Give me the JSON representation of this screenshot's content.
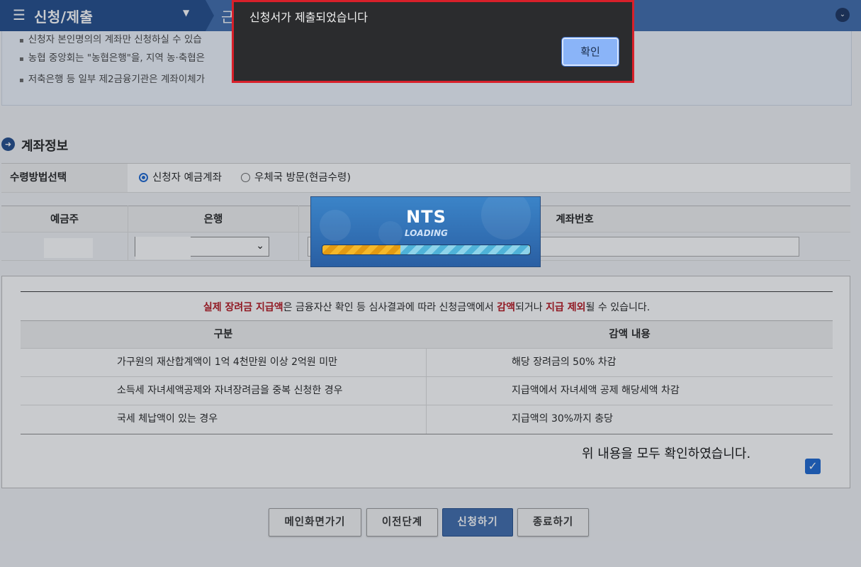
{
  "topbar": {
    "menu_icon": "☰",
    "menu_title": "신청/제출",
    "menu_caret": "▼",
    "next_crumb": "근",
    "collapse_icon": "⌄"
  },
  "notice": {
    "items": [
      "신청자 본인명의의 계좌만 신청하실 수 있습",
      "농협 중앙회는 \"농협은행\"을, 지역 농·축협은",
      "저축은행 등 일부 제2금융기관은 계좌이체가"
    ]
  },
  "account_section": {
    "title": "계좌정보",
    "method_label": "수령방법선택",
    "options": [
      {
        "label": "신청자 예금계좌",
        "selected": true
      },
      {
        "label": "우체국 방문(현금수령)",
        "selected": false
      }
    ],
    "columns": [
      "예금주",
      "은행",
      "계좌번호"
    ],
    "bank_select_value": ""
  },
  "info_panel": {
    "warning": {
      "p1": "실제 장려금 지급액",
      "p2": "은 금융자산 확인 등 심사결과에 따라 신청금액에서 ",
      "p3": "감액",
      "p4": "되거나 ",
      "p5": "지급 제외",
      "p6": "될 수 있습니다."
    },
    "headers": [
      "구분",
      "감액 내용"
    ],
    "rows": [
      [
        "가구원의 재산합계액이 1억 4천만원 이상 2억원 미만",
        "해당 장려금의 50% 차감"
      ],
      [
        "소득세 자녀세액공제와 자녀장려금을 중복 신청한 경우",
        "지급액에서 자녀세액 공제 해당세액 차감"
      ],
      [
        "국세 체납액이 있는 경우",
        "지급액의 30%까지 충당"
      ]
    ],
    "confirm_text": "위 내용을 모두 확인하였습니다.",
    "confirm_checked": true,
    "check_mark": "✓"
  },
  "buttons": {
    "main": "메인화면가기",
    "prev": "이전단계",
    "apply": "신청하기",
    "exit": "종료하기"
  },
  "loading": {
    "brand": "NTS",
    "text": "LOADING"
  },
  "dialog": {
    "message": "신청서가 제출되었습니다",
    "ok_label": "확인"
  },
  "colors": {
    "brand_blue": "#1f4a8a",
    "accent_red": "#b5121b",
    "dialog_border": "#d8202a"
  }
}
